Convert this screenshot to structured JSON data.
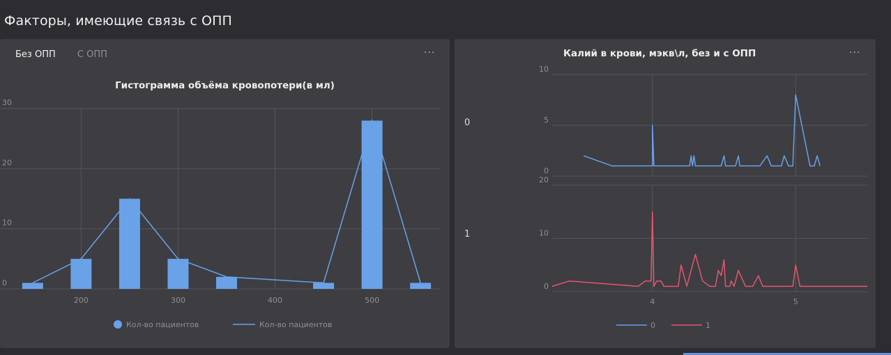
{
  "page": {
    "title": "Факторы, имеющие связь с ОПП"
  },
  "left_panel": {
    "tabs": [
      {
        "label": "Без ОПП",
        "active": true
      },
      {
        "label": "С ОПП",
        "active": false
      }
    ],
    "menu_icon": "more-dots-icon",
    "menu_label": "···"
  },
  "right_panel": {
    "menu_icon": "more-dots-icon",
    "menu_label": "···",
    "facet_labels": [
      "0",
      "1"
    ]
  },
  "colors": {
    "blue": "#6aa2e8",
    "red": "#e5566f",
    "grid": "#55555b",
    "axis_text": "#8f8f94"
  },
  "chart_data": [
    {
      "type": "bar",
      "title": "Гистограмма объёма кровопотери(в мл)",
      "x": [
        150,
        200,
        250,
        300,
        350,
        450,
        500,
        550
      ],
      "values": [
        1,
        5,
        15,
        5,
        2,
        1,
        28,
        1
      ],
      "xticks": [
        200,
        300,
        400,
        500
      ],
      "yticks": [
        0,
        10,
        20,
        30
      ],
      "xlim": [
        130,
        570
      ],
      "ylim": [
        0,
        30
      ],
      "grid": true,
      "legend_position": "bottom",
      "series": [
        {
          "name": "Кол-во пациентов",
          "kind": "bar",
          "color": "#6aa2e8"
        },
        {
          "name": "Кол-во пациентов",
          "kind": "line",
          "color": "#6aa2e8"
        }
      ]
    },
    {
      "type": "line",
      "title": "Калий в крови, мэкв\\л, без и с ОПП",
      "xticks": [
        4,
        5
      ],
      "xlim": [
        3.3,
        5.5
      ],
      "grid": true,
      "legend_position": "bottom",
      "facets": [
        {
          "label": "0",
          "name": "0",
          "color": "#6aa2e8",
          "ylim": [
            0,
            10
          ],
          "yticks": [
            0,
            5,
            10
          ],
          "points": [
            [
              3.52,
              2
            ],
            [
              3.72,
              1
            ],
            [
              4.0,
              1
            ],
            [
              4.0,
              5
            ],
            [
              4.01,
              1
            ],
            [
              4.2,
              1
            ],
            [
              4.26,
              1
            ],
            [
              4.27,
              2
            ],
            [
              4.28,
              1
            ],
            [
              4.29,
              2
            ],
            [
              4.3,
              1
            ],
            [
              4.48,
              1
            ],
            [
              4.5,
              2
            ],
            [
              4.51,
              1
            ],
            [
              4.58,
              1
            ],
            [
              4.6,
              2
            ],
            [
              4.61,
              1
            ],
            [
              4.75,
              1
            ],
            [
              4.8,
              2
            ],
            [
              4.83,
              1
            ],
            [
              4.9,
              1
            ],
            [
              4.92,
              2
            ],
            [
              4.95,
              1
            ],
            [
              4.98,
              1
            ],
            [
              5.0,
              8
            ],
            [
              5.1,
              1
            ],
            [
              5.13,
              1
            ],
            [
              5.15,
              2
            ],
            [
              5.17,
              1
            ]
          ]
        },
        {
          "label": "1",
          "name": "1",
          "color": "#e5566f",
          "ylim": [
            0,
            20
          ],
          "yticks": [
            0,
            10,
            20
          ],
          "points": [
            [
              3.3,
              1
            ],
            [
              3.42,
              2
            ],
            [
              3.9,
              1
            ],
            [
              3.95,
              2
            ],
            [
              3.99,
              2
            ],
            [
              4.0,
              15
            ],
            [
              4.01,
              1
            ],
            [
              4.03,
              2
            ],
            [
              4.06,
              2
            ],
            [
              4.08,
              1
            ],
            [
              4.18,
              1
            ],
            [
              4.2,
              5
            ],
            [
              4.24,
              1
            ],
            [
              4.3,
              7
            ],
            [
              4.35,
              2
            ],
            [
              4.4,
              1
            ],
            [
              4.44,
              1
            ],
            [
              4.46,
              4
            ],
            [
              4.48,
              3
            ],
            [
              4.5,
              6
            ],
            [
              4.51,
              1
            ],
            [
              4.54,
              1
            ],
            [
              4.55,
              2
            ],
            [
              4.57,
              1
            ],
            [
              4.6,
              4
            ],
            [
              4.65,
              1
            ],
            [
              4.7,
              1
            ],
            [
              4.74,
              3
            ],
            [
              4.77,
              1
            ],
            [
              4.98,
              1
            ],
            [
              5.0,
              5
            ],
            [
              5.03,
              1
            ],
            [
              5.5,
              1
            ]
          ]
        }
      ]
    }
  ]
}
